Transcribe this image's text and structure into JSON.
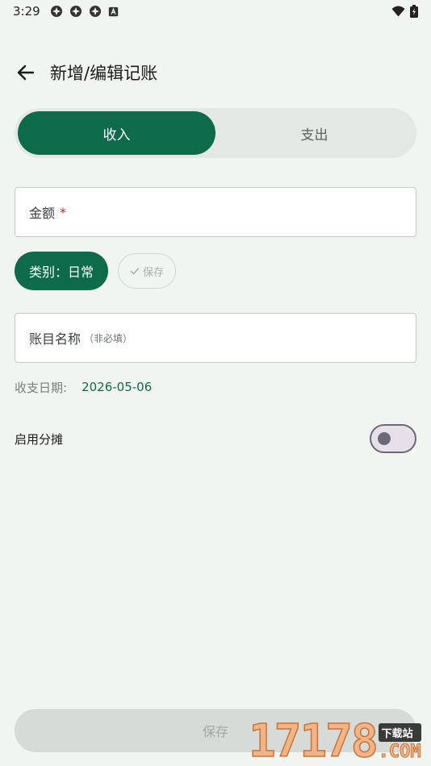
{
  "status_bar": {
    "time": "3:29",
    "left_icons": [
      "app-notification-icon",
      "app-notification-icon",
      "app-notification-icon",
      "accessibility-icon"
    ],
    "right_icons": [
      "wifi-icon",
      "battery-charging-icon"
    ]
  },
  "app_bar": {
    "back_icon": "arrow-left-icon",
    "title": "新增/编辑记账"
  },
  "type_toggle": {
    "income_label": "收入",
    "expense_label": "支出",
    "selected": "收入"
  },
  "amount_field": {
    "label": "金额",
    "required_mark": "*",
    "value": ""
  },
  "category_chip": {
    "label": "类别：日常"
  },
  "save_chip": {
    "icon": "check-icon",
    "label": "保存"
  },
  "name_field": {
    "label": "账目名称",
    "hint": "（非必填）",
    "value": ""
  },
  "date_row": {
    "label": "收支日期:",
    "value": "2026-05-06"
  },
  "split_row": {
    "label": "启用分摊",
    "enabled": false
  },
  "bottom_button": {
    "label": "保存"
  },
  "watermark": {
    "digits": "17178",
    "tag": "下载站",
    "suffix": ".COM"
  },
  "colors": {
    "primary": "#0d6b4b",
    "background": "#f1f5f2",
    "required": "#c62828"
  }
}
